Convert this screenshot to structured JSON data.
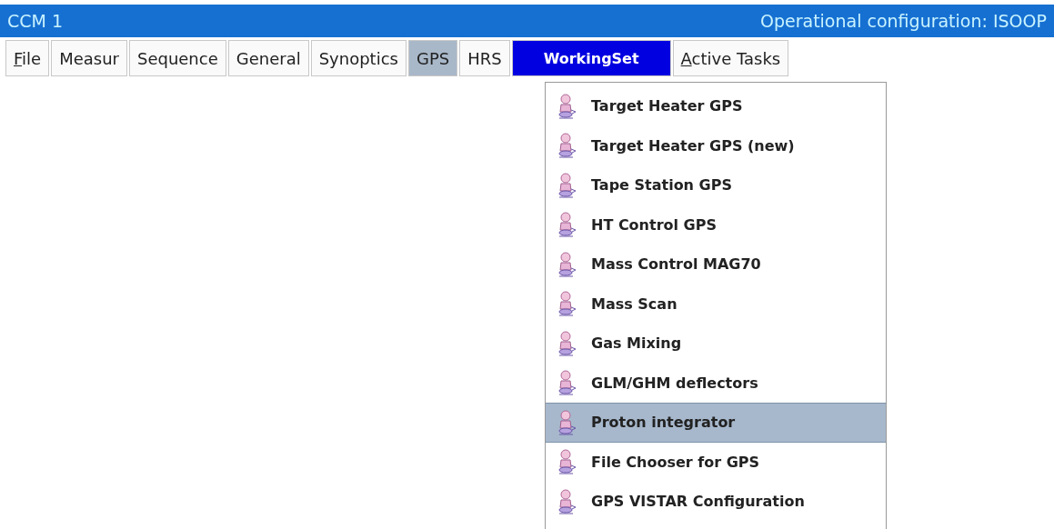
{
  "window": {
    "title": "CCM 1",
    "configuration": "Operational configuration: ISOOP"
  },
  "menu_bar": [
    {
      "label": "File",
      "mnemonic": true,
      "open": false,
      "highlighted": false
    },
    {
      "label": "Measur",
      "mnemonic": false,
      "open": false,
      "highlighted": false
    },
    {
      "label": "Sequence",
      "mnemonic": false,
      "open": false,
      "highlighted": false
    },
    {
      "label": "General",
      "mnemonic": false,
      "open": false,
      "highlighted": false
    },
    {
      "label": "Synoptics",
      "mnemonic": false,
      "open": false,
      "highlighted": false
    },
    {
      "label": "GPS",
      "mnemonic": false,
      "open": true,
      "highlighted": false
    },
    {
      "label": "HRS",
      "mnemonic": false,
      "open": false,
      "highlighted": false
    },
    {
      "label": "WorkingSet",
      "mnemonic": false,
      "open": false,
      "highlighted": true
    },
    {
      "label": "Active Tasks",
      "mnemonic": true,
      "open": false,
      "highlighted": false
    }
  ],
  "dropdown": {
    "items": [
      {
        "label": "Target Heater GPS",
        "selected": false
      },
      {
        "label": "Target Heater GPS (new)",
        "selected": false
      },
      {
        "label": "Tape Station GPS",
        "selected": false
      },
      {
        "label": "HT Control GPS",
        "selected": false
      },
      {
        "label": "Mass Control MAG70",
        "selected": false
      },
      {
        "label": "Mass Scan",
        "selected": false
      },
      {
        "label": "Gas Mixing",
        "selected": false
      },
      {
        "label": "GLM/GHM deflectors",
        "selected": false
      },
      {
        "label": "Proton integrator",
        "selected": true
      },
      {
        "label": "File Chooser for GPS",
        "selected": false
      },
      {
        "label": "GPS VISTAR Configuration",
        "selected": false
      }
    ]
  }
}
